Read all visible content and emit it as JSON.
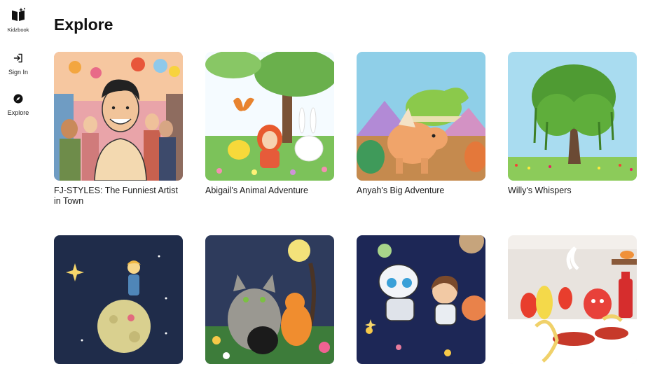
{
  "app": {
    "name": "Kidzbook"
  },
  "nav": {
    "sign_in": "Sign In",
    "explore": "Explore"
  },
  "page": {
    "title": "Explore"
  },
  "books": [
    {
      "title": "FJ-STYLES: The Funniest Artist in Town"
    },
    {
      "title": "Abigail's Animal Adventure"
    },
    {
      "title": "Anyah's Big Adventure"
    },
    {
      "title": "Willy's Whispers"
    },
    {
      "title": ""
    },
    {
      "title": ""
    },
    {
      "title": ""
    },
    {
      "title": ""
    }
  ]
}
